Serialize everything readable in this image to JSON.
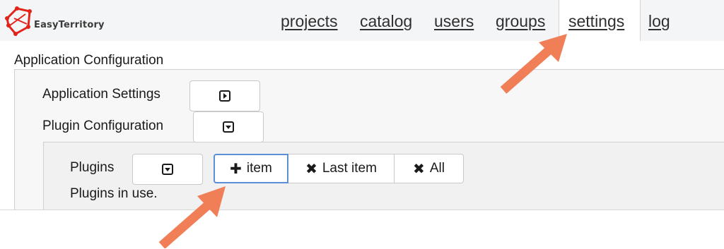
{
  "brand": {
    "name": "EasyTerritory",
    "color": "#e2231a"
  },
  "nav": {
    "items": [
      "projects",
      "catalog",
      "users",
      "groups",
      "settings",
      "log"
    ],
    "active": "settings"
  },
  "config": {
    "title": "Application Configuration",
    "application_settings_label": "Application Settings",
    "plugin_configuration_label": "Plugin Configuration"
  },
  "plugins": {
    "label": "Plugins",
    "description": "Plugins in use.",
    "add_item_label": "item",
    "remove_last_label": "Last item",
    "remove_all_label": "All"
  },
  "icons": {
    "application_settings_toggle": "caret-right-square-icon",
    "plugin_configuration_toggle": "caret-down-square-icon",
    "plugins_toggle": "caret-down-square-icon",
    "add": "plus-icon",
    "remove": "x-icon"
  },
  "colors": {
    "annotation_arrow": "#f07f57",
    "focused_border": "#5b8fd6"
  }
}
